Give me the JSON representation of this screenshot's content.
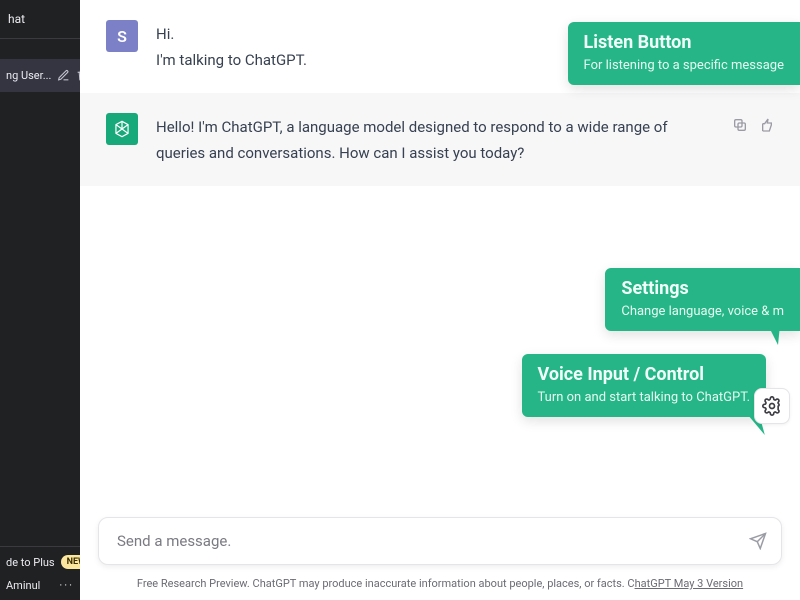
{
  "sidebar": {
    "new_chat_label": "hat",
    "history_item_label": "ng User...",
    "upgrade_label": "de to Plus",
    "upgrade_badge": "NEW",
    "account_label": "Aminul"
  },
  "messages": {
    "user": {
      "initial": "S",
      "line1": "Hi.",
      "line2": "I'm talking to ChatGPT."
    },
    "assistant": {
      "text": "Hello! I'm ChatGPT, a language model designed to respond to a wide range of queries and conversations. How can I assist you today?"
    }
  },
  "composer": {
    "placeholder": "Send a message."
  },
  "footnote": {
    "text": "Free Research Preview. ChatGPT may produce inaccurate information about people, places, or facts. C",
    "version_label": "hatGPT May 3 Version"
  },
  "callouts": {
    "listen": {
      "title": "Listen Button",
      "sub": "For listening to a specific message"
    },
    "settings": {
      "title": "Settings",
      "sub": "Change language, voice & m"
    },
    "voice": {
      "title": "Voice Input / Control",
      "sub": "Turn on and start talking to ChatGPT."
    }
  }
}
